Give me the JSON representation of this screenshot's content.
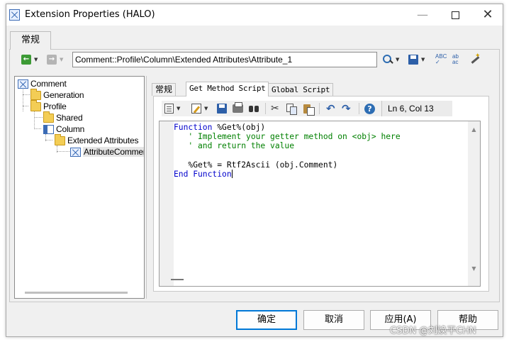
{
  "window": {
    "title": "Extension Properties (HALO)"
  },
  "outer_tab": {
    "label": "常规"
  },
  "path_combo": {
    "value": "Comment::Profile\\Column\\Extended Attributes\\Attribute_1"
  },
  "tree": {
    "items": [
      {
        "label": "Comment"
      },
      {
        "label": "Generation"
      },
      {
        "label": "Profile"
      },
      {
        "label": "Shared"
      },
      {
        "label": "Column"
      },
      {
        "label": "Extended Attributes"
      },
      {
        "label": "AttributeComment"
      }
    ]
  },
  "inner_tabs": [
    {
      "label": "常规"
    },
    {
      "label": "Get Method Script"
    },
    {
      "label": "Global Script"
    }
  ],
  "script_toolbar": {
    "position": "Ln 6, Col 13"
  },
  "editor": {
    "line1_kw": "Function",
    "line1_rest": " %Get%(obj)",
    "line2": "   ' Implement your getter method on <obj> here",
    "line3": "   ' and return the value",
    "line5": "   %Get% = Rtf2Ascii (obj.Comment)",
    "line6": "End Function"
  },
  "buttons": {
    "ok": "确定",
    "cancel": "取消",
    "apply": "应用(A)",
    "help": "帮助"
  },
  "watermark": "CSDN @刘焕平CHN"
}
